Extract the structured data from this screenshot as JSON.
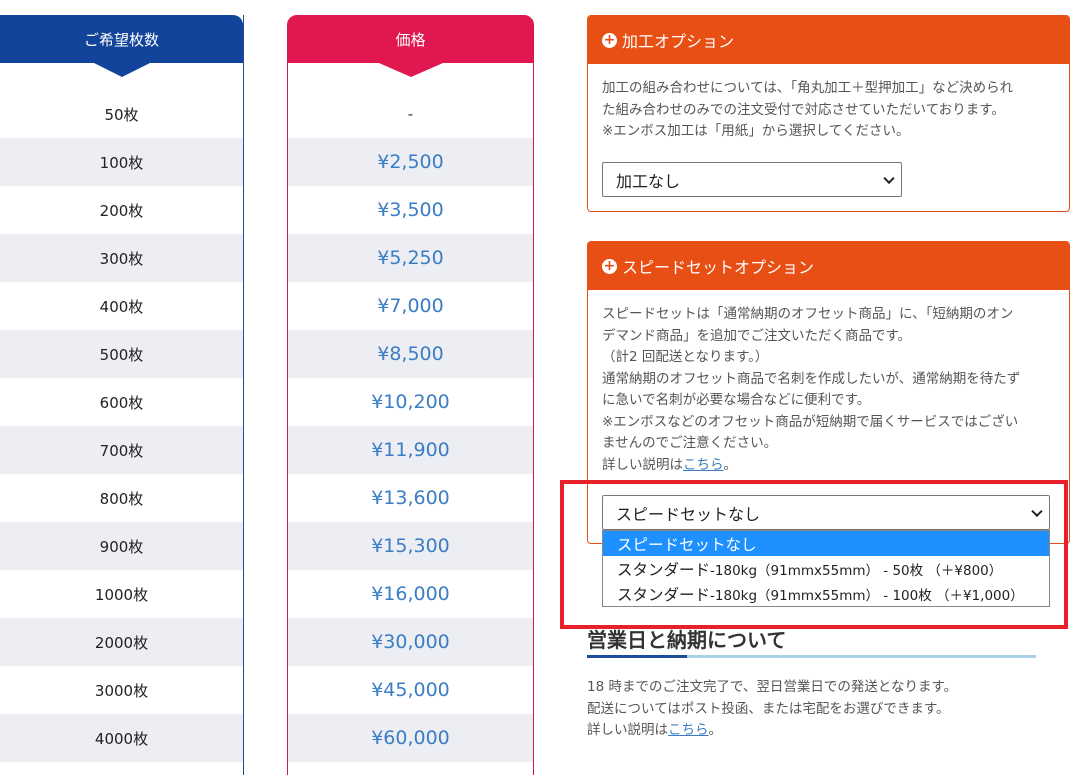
{
  "quantity_header": "ご希望枚数",
  "price_header": "価格",
  "rows": [
    {
      "qty": "50枚",
      "price": "-"
    },
    {
      "qty": "100枚",
      "price": "¥2,500"
    },
    {
      "qty": "200枚",
      "price": "¥3,500"
    },
    {
      "qty": "300枚",
      "price": "¥5,250"
    },
    {
      "qty": "400枚",
      "price": "¥7,000"
    },
    {
      "qty": "500枚",
      "price": "¥8,500"
    },
    {
      "qty": "600枚",
      "price": "¥10,200"
    },
    {
      "qty": "700枚",
      "price": "¥11,900"
    },
    {
      "qty": "800枚",
      "price": "¥13,600"
    },
    {
      "qty": "900枚",
      "price": "¥15,300"
    },
    {
      "qty": "1000枚",
      "price": "¥16,000"
    },
    {
      "qty": "2000枚",
      "price": "¥30,000"
    },
    {
      "qty": "3000枚",
      "price": "¥45,000"
    },
    {
      "qty": "4000枚",
      "price": "¥60,000"
    }
  ],
  "processing": {
    "title": "加工オプション",
    "icon": "plus-circle-icon",
    "lines": [
      "加工の組み合わせについては、「角丸加工＋型押加工」など決められ",
      "た組み合わせのみでの注文受付で対応させていただいております。",
      "※エンボス加工は「用紙」から選択してください。"
    ],
    "select_value": "加工なし"
  },
  "speedset": {
    "title": "スピードセットオプション",
    "icon": "plus-circle-icon",
    "lines": [
      "スピードセットは「通常納期のオフセット商品」に、「短納期のオン",
      "デマンド商品」を追加でご注文いただく商品です。",
      "（計2 回配送となります。）",
      "通常納期のオフセット商品で名刺を作成したいが、通常納期を待たず",
      "に急いで名刺が必要な場合などに便利です。",
      "※エンボスなどのオフセット商品が短納期で届くサービスではござい",
      "ませんのでご注意ください。"
    ],
    "detail_prefix": "詳しい説明は",
    "detail_link": "こちら",
    "detail_suffix": "。",
    "select_value": "スピードセットなし",
    "options": [
      {
        "main": "スピードセットなし",
        "sub": ""
      },
      {
        "main": "スタンダード",
        "sub": "-180kg（91mmx55mm） - 50枚 （＋¥800）"
      },
      {
        "main": "スタンダード",
        "sub": "-180kg（91mmx55mm） - 100枚 （＋¥1,000）"
      }
    ],
    "selected_index": 0
  },
  "delivery": {
    "title": "営業日と納期について",
    "lines": [
      "18 時までのご注文完了で、翌日営業日での発送となります。",
      "配送についてはポスト投函、または宅配をお選びできます。"
    ],
    "detail_prefix": "詳しい説明は",
    "detail_link": "こちら",
    "detail_suffix": "。"
  },
  "colors": {
    "quantity_header": "#13449b",
    "price_header": "#e0184f",
    "price_text": "#3b7dc4",
    "option_header": "#e84f14",
    "highlight": "#e8202a",
    "selected_option": "#1e90ff"
  }
}
